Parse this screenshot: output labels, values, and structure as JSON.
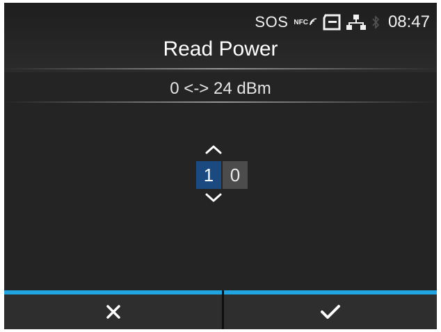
{
  "status": {
    "sos": "SOS",
    "nfc": "NFC",
    "time": "08:47",
    "icons": [
      "nfc-icon",
      "sd-card-icon",
      "network-icon",
      "bluetooth-icon"
    ]
  },
  "screen": {
    "title": "Read Power",
    "range": "0 <-> 24 dBm"
  },
  "editor": {
    "digits": [
      "1",
      "0"
    ],
    "selected_index": 0
  },
  "buttons": {
    "cancel_icon": "close-icon",
    "confirm_icon": "checkmark-icon"
  },
  "colors": {
    "accent": "#20a5e1",
    "selected_digit": "#1b4a80",
    "background": "#242424"
  }
}
